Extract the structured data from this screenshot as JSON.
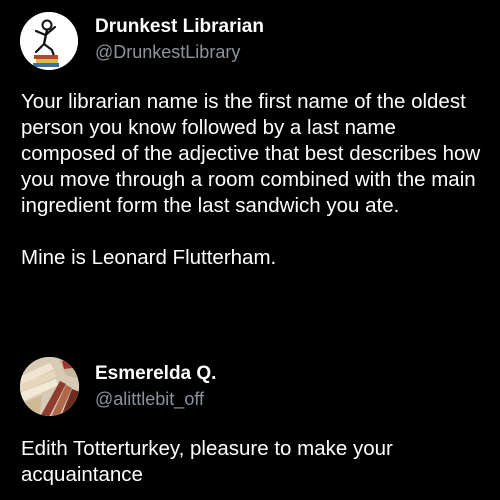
{
  "main_tweet": {
    "avatar_icon": "librarian-stick-figure-icon",
    "display_name": "Drunkest Librarian",
    "handle": "@DrunkestLibrary",
    "paragraphs": [
      "Your librarian name is the first name of the oldest person you know followed by a last name composed of the adjective that best describes how you move through a room combined with the main ingredient form the last sandwich you ate.",
      "Mine is Leonard Flutterham."
    ]
  },
  "reply_tweet": {
    "avatar_icon": "books-avatar-icon",
    "display_name": "Esmerelda Q.",
    "handle": "@alittlebit_off",
    "text": "Edith Totterturkey, pleasure to make your acquaintance"
  },
  "colors": {
    "background": "#000000",
    "primary_text": "#ffffff",
    "secondary_text": "#8b949c"
  }
}
